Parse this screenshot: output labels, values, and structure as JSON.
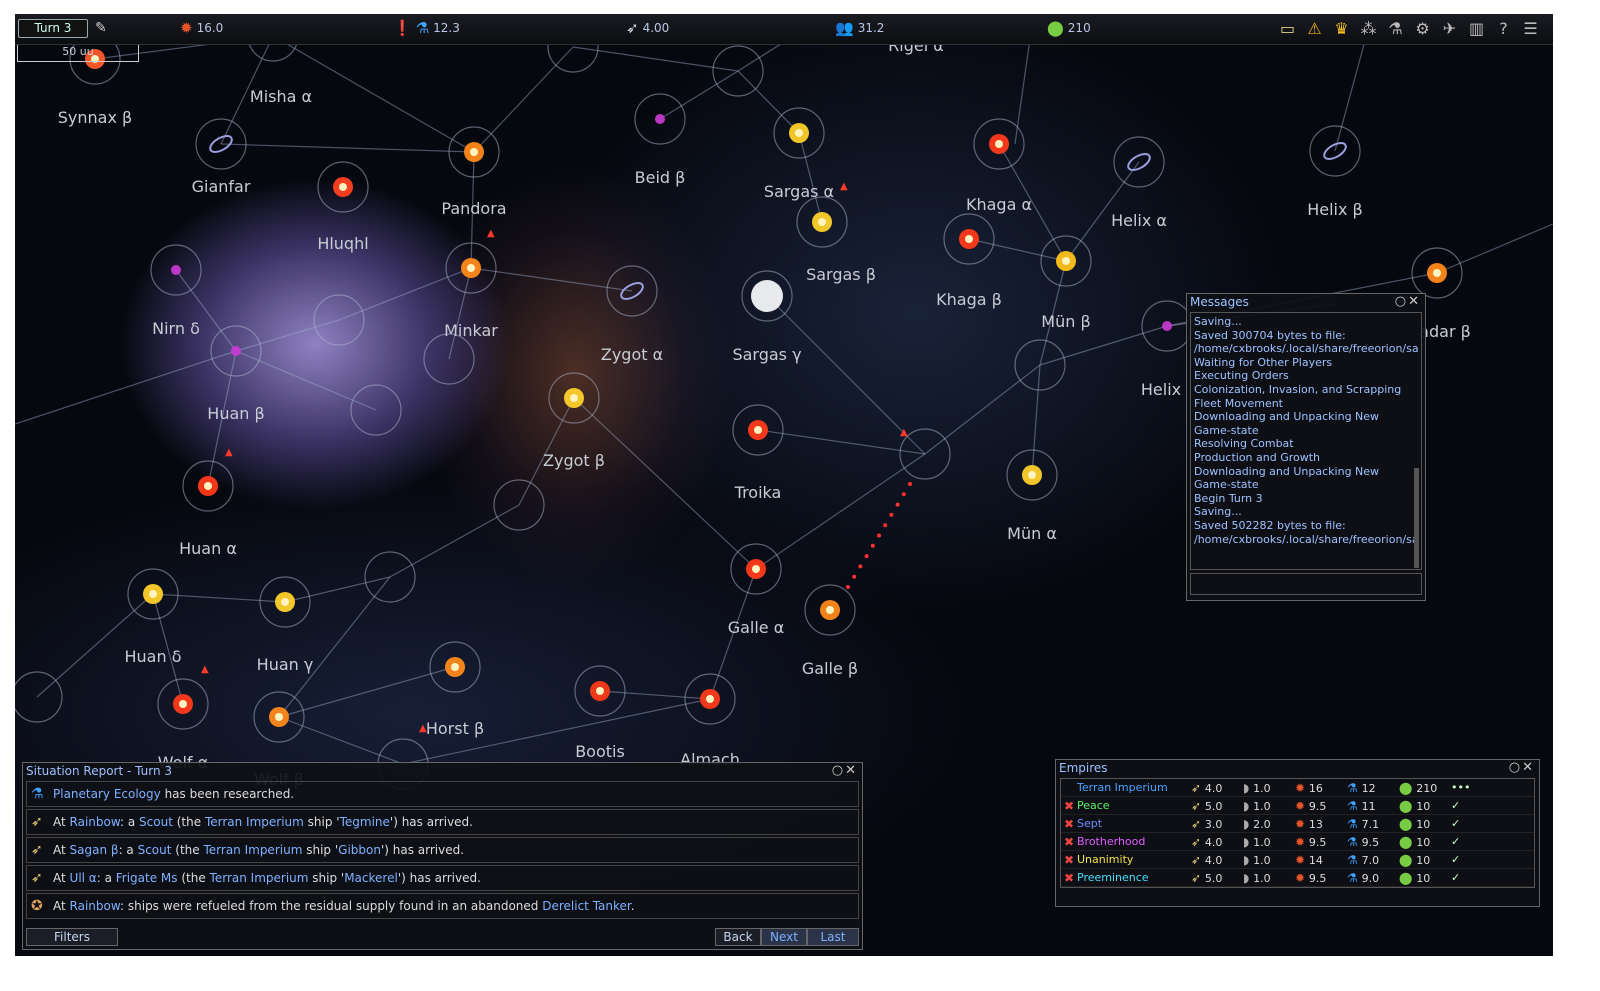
{
  "topbar": {
    "turn": "Turn 3",
    "industry": "16.0",
    "research": "12.3",
    "fleet": "4.00",
    "population": "31.2",
    "influence": "210",
    "scale": "50 uu",
    "icons": [
      "pedia-icon",
      "warning-icon",
      "government-icon",
      "objects-icon",
      "research-icon",
      "production-icon",
      "design-icon",
      "graph-icon",
      "help-icon",
      "menu-icon"
    ]
  },
  "map": {
    "systems": [
      {
        "name": "Synnax β"
      },
      {
        "name": "Misha α"
      },
      {
        "name": "Gianfar"
      },
      {
        "name": "Hluqhl"
      },
      {
        "name": "Pandora"
      },
      {
        "name": "Beid β"
      },
      {
        "name": "Sargas α"
      },
      {
        "name": "Sargas β"
      },
      {
        "name": "Sargas γ"
      },
      {
        "name": "Rigel α"
      },
      {
        "name": "Khaga α"
      },
      {
        "name": "Khaga β"
      },
      {
        "name": "Helix α"
      },
      {
        "name": "Helix β"
      },
      {
        "name": "Mün β"
      },
      {
        "name": "Mün α"
      },
      {
        "name": "Helix"
      },
      {
        "name": "adar β"
      },
      {
        "name": "Nirn δ"
      },
      {
        "name": "Minkar"
      },
      {
        "name": "Zygot α"
      },
      {
        "name": "Zygot β"
      },
      {
        "name": "Huan β"
      },
      {
        "name": "Huan α"
      },
      {
        "name": "Troika"
      },
      {
        "name": "Galle α"
      },
      {
        "name": "Galle β"
      },
      {
        "name": "Huan δ"
      },
      {
        "name": "Huan γ"
      },
      {
        "name": "Horst β"
      },
      {
        "name": "Bootis"
      },
      {
        "name": "Almach"
      },
      {
        "name": "Wolf α"
      },
      {
        "name": "Wolf β"
      }
    ]
  },
  "messages": {
    "title": "Messages",
    "lines": [
      "Saving...",
      "Saved 300704 bytes to file:",
      "/home/cxbrooks/.local/share/freeorion/sa",
      "Waiting for Other Players",
      "Executing Orders",
      "Colonization, Invasion, and Scrapping",
      "Fleet Movement",
      "Downloading and Unpacking New",
      "Game-state",
      "Resolving Combat",
      "Production and Growth",
      "Downloading and Unpacking New",
      "Game-state",
      "Begin Turn 3",
      "Saving...",
      "Saved 502282 bytes to file:",
      "/home/cxbrooks/.local/share/freeorion/sa"
    ]
  },
  "sitrep": {
    "title": "Situation Report - Turn 3",
    "rows": [
      {
        "icon": "research-icon",
        "parts": [
          [
            "Planetary Ecology",
            true
          ],
          [
            " has been researched.",
            false
          ]
        ]
      },
      {
        "icon": "ship-icon",
        "parts": [
          [
            "At ",
            false
          ],
          [
            "Rainbow",
            true
          ],
          [
            ": a ",
            false
          ],
          [
            "Scout",
            true
          ],
          [
            " (the ",
            false
          ],
          [
            "Terran Imperium",
            true
          ],
          [
            " ship '",
            false
          ],
          [
            "Tegmine",
            true
          ],
          [
            "') has arrived.",
            false
          ]
        ]
      },
      {
        "icon": "ship-icon",
        "parts": [
          [
            "At ",
            false
          ],
          [
            "Sagan β",
            true
          ],
          [
            ": a ",
            false
          ],
          [
            "Scout",
            true
          ],
          [
            " (the ",
            false
          ],
          [
            "Terran Imperium",
            true
          ],
          [
            " ship '",
            false
          ],
          [
            "Gibbon",
            true
          ],
          [
            "') has arrived.",
            false
          ]
        ]
      },
      {
        "icon": "ship-icon",
        "parts": [
          [
            "At ",
            false
          ],
          [
            "Ull α",
            true
          ],
          [
            ": a ",
            false
          ],
          [
            "Frigate Ms",
            true
          ],
          [
            " (the ",
            false
          ],
          [
            "Terran Imperium",
            true
          ],
          [
            " ship '",
            false
          ],
          [
            "Mackerel",
            true
          ],
          [
            "') has arrived.",
            false
          ]
        ]
      },
      {
        "icon": "derelict-icon",
        "parts": [
          [
            "At ",
            false
          ],
          [
            "Rainbow",
            true
          ],
          [
            ": ships were refueled from the residual supply found in an abandoned ",
            false
          ],
          [
            "Derelict Tanker",
            true
          ],
          [
            ".",
            false
          ]
        ]
      }
    ],
    "filters": "Filters",
    "back": "Back",
    "next": "Next",
    "last": "Last"
  },
  "empires": {
    "title": "Empires",
    "rows": [
      {
        "name": "Terran Imperium",
        "color": "#4aa3ff",
        "ships": "4.0",
        "a": "1.0",
        "ind": "16",
        "res": "12",
        "inf": "210",
        "status": "•••",
        "x": false
      },
      {
        "name": "Peace",
        "color": "#5ff06a",
        "ships": "5.0",
        "a": "1.0",
        "ind": "9.5",
        "res": "11",
        "inf": "10",
        "status": "✓",
        "x": true
      },
      {
        "name": "Sept",
        "color": "#6f8cff",
        "ships": "3.0",
        "a": "2.0",
        "ind": "13",
        "res": "7.1",
        "inf": "10",
        "status": "✓",
        "x": true
      },
      {
        "name": "Brotherhood",
        "color": "#e35cff",
        "ships": "4.0",
        "a": "1.0",
        "ind": "9.5",
        "res": "9.5",
        "inf": "10",
        "status": "✓",
        "x": true
      },
      {
        "name": "Unanimity",
        "color": "#f0e34a",
        "ships": "4.0",
        "a": "1.0",
        "ind": "14",
        "res": "7.0",
        "inf": "10",
        "status": "✓",
        "x": true
      },
      {
        "name": "Preeminence",
        "color": "#4adfff",
        "ships": "5.0",
        "a": "1.0",
        "ind": "9.5",
        "res": "9.0",
        "inf": "10",
        "status": "✓",
        "x": true
      }
    ]
  },
  "colors": {
    "accent": "#9fc1ff",
    "link": "#7fb1ff",
    "panel": "#0e1016"
  }
}
